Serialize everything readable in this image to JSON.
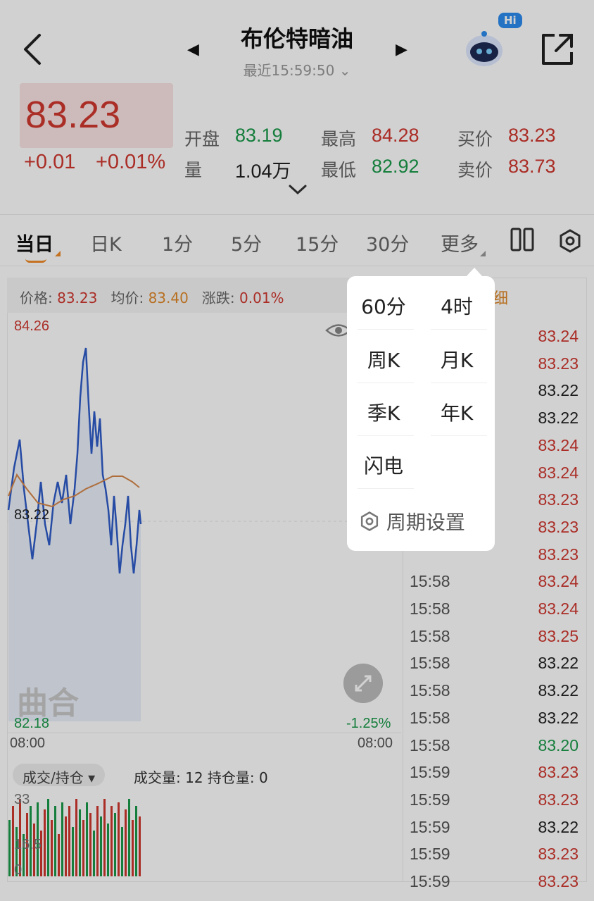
{
  "header": {
    "title": "布伦特暗油",
    "subtitle": "最近15:59:50",
    "hi_badge": "Hi"
  },
  "quote": {
    "price": "83.23",
    "change": "+0.01",
    "change_pct": "+0.01%",
    "open_label": "开盘",
    "open_value": "83.19",
    "volume_label": "量",
    "volume_value": "1.04万",
    "high_label": "最高",
    "high_value": "84.28",
    "low_label": "最低",
    "low_value": "82.92",
    "bid_label": "买价",
    "bid_value": "83.23",
    "ask_label": "卖价",
    "ask_value": "83.73"
  },
  "tabs": [
    "当日",
    "日K",
    "1分",
    "5分",
    "15分",
    "30分",
    "更多"
  ],
  "chart": {
    "info_price_label": "价格:",
    "info_price": "83.23",
    "info_avg_label": "均价:",
    "info_avg": "83.40",
    "info_chg_label": "涨跌:",
    "info_chg": "0.01%",
    "y_max": "84.26",
    "y_mid": "83.22",
    "y_min": "82.18",
    "pct_min": "-1.25%",
    "x_start": "08:00",
    "x_end": "08:00",
    "watermark": "曲合",
    "vol_selector": "成交/持仓",
    "vol_info": "成交量: 12 持仓量: 0",
    "vol_max": "33",
    "vol_mid": "16.5",
    "vol_zero": "0"
  },
  "ticks_header": "细",
  "ticks": [
    {
      "time": "",
      "price": "83.24",
      "color": "red"
    },
    {
      "time": "",
      "price": "83.23",
      "color": "red"
    },
    {
      "time": "",
      "price": "83.22",
      "color": "black"
    },
    {
      "time": "",
      "price": "83.22",
      "color": "black"
    },
    {
      "time": "",
      "price": "83.24",
      "color": "red"
    },
    {
      "time": "",
      "price": "83.24",
      "color": "red"
    },
    {
      "time": "",
      "price": "83.23",
      "color": "red"
    },
    {
      "time": "",
      "price": "83.23",
      "color": "red"
    },
    {
      "time": "",
      "price": "83.23",
      "color": "red"
    },
    {
      "time": "15:58",
      "price": "83.24",
      "color": "red"
    },
    {
      "time": "15:58",
      "price": "83.24",
      "color": "red"
    },
    {
      "time": "15:58",
      "price": "83.25",
      "color": "red"
    },
    {
      "time": "15:58",
      "price": "83.22",
      "color": "black"
    },
    {
      "time": "15:58",
      "price": "83.22",
      "color": "black"
    },
    {
      "time": "15:58",
      "price": "83.22",
      "color": "black"
    },
    {
      "time": "15:58",
      "price": "83.20",
      "color": "green"
    },
    {
      "time": "15:59",
      "price": "83.23",
      "color": "red"
    },
    {
      "time": "15:59",
      "price": "83.23",
      "color": "red"
    },
    {
      "time": "15:59",
      "price": "83.22",
      "color": "black"
    },
    {
      "time": "15:59",
      "price": "83.23",
      "color": "red"
    },
    {
      "time": "15:59",
      "price": "83.23",
      "color": "red"
    }
  ],
  "popup": {
    "items": [
      "60分",
      "4时",
      "周K",
      "月K",
      "季K",
      "年K",
      "闪电"
    ],
    "settings_label": "周期设置"
  },
  "colors": {
    "up": "#d0372f",
    "down": "#1a9a4a",
    "accent": "#f08c2a",
    "line": "#2f5cc8"
  }
}
